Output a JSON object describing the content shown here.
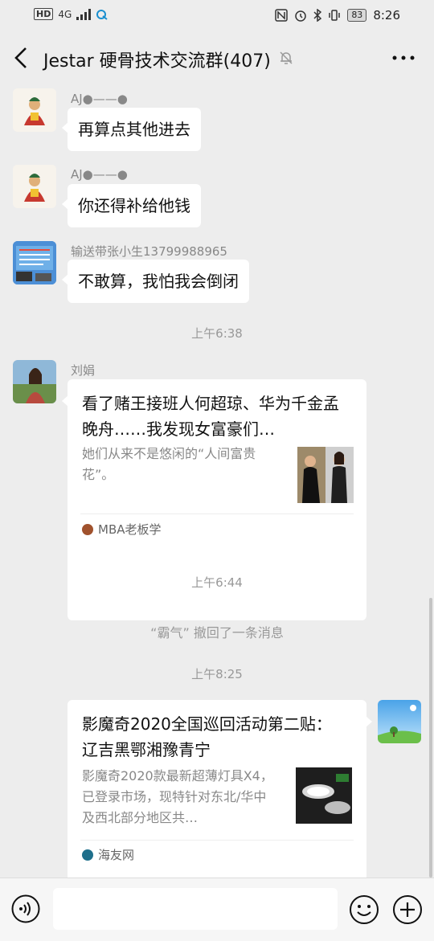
{
  "status_bar": {
    "hd": "HD",
    "network": "4G",
    "battery": "83",
    "time": "8:26"
  },
  "header": {
    "title": "Jestar 硬骨技术交流群(407)"
  },
  "messages": [
    {
      "sender": "AJ●——●",
      "text": "再算点其他进去"
    },
    {
      "sender": "AJ●——●",
      "text": "你还得补给他钱"
    },
    {
      "sender": "输送带张小生13799988965",
      "text": "不敢算，我怕我会倒闭"
    }
  ],
  "times": [
    "上午6:38",
    "上午6:44",
    "上午8:25"
  ],
  "card1": {
    "sender": "刘娟",
    "title": "看了赌王接班人何超琼、华为千金孟晚舟……我发现女富豪们…",
    "desc": "她们从来不是悠闲的“人间富贵花”。",
    "source": "MBA老板学"
  },
  "system_notice": "“霸气” 撤回了一条消息",
  "card2": {
    "title": "影魔奇2020全国巡回活动第二贴： 辽吉黑鄂湘豫青宁",
    "desc": "影魔奇2020款最新超薄灯具X4，已登录市场，现特针对东北/华中及西北部分地区共…",
    "source": "海友网"
  },
  "colors": {
    "background": "#ededed",
    "bubble": "#ffffff",
    "meta_text": "#999999"
  }
}
